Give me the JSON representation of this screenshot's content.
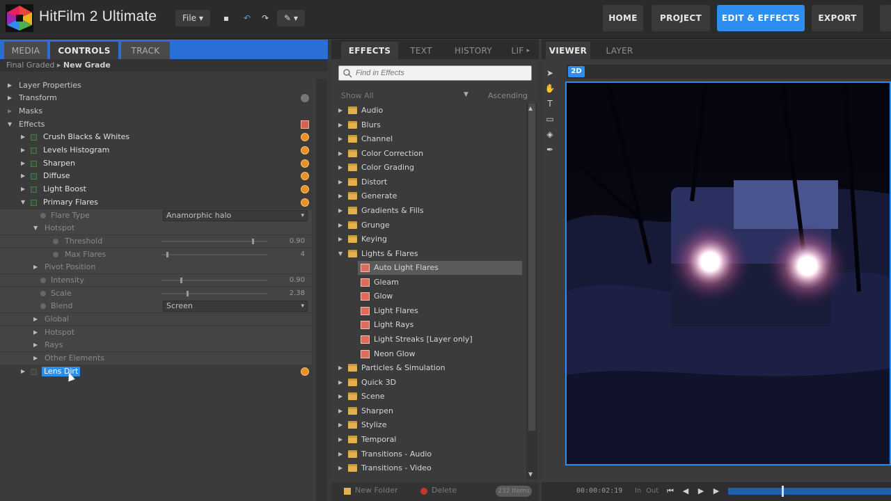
{
  "app": {
    "title": "HitFilm 2 Ultimate",
    "file_menu": "File",
    "nav": [
      "HOME",
      "PROJECT",
      "EDIT & EFFECTS",
      "EXPORT"
    ]
  },
  "left_panel": {
    "tabs": [
      "MEDIA",
      "CONTROLS",
      "TRACK"
    ],
    "breadcrumb": {
      "parent": "Final Graded",
      "current": "New Grade"
    },
    "rows": [
      {
        "label": "Layer Properties"
      },
      {
        "label": "Transform"
      },
      {
        "label": "Masks"
      },
      {
        "label": "Effects"
      },
      {
        "label": "Crush Blacks & Whites"
      },
      {
        "label": "Levels Histogram"
      },
      {
        "label": "Sharpen"
      },
      {
        "label": "Diffuse"
      },
      {
        "label": "Light Boost"
      },
      {
        "label": "Primary Flares"
      },
      {
        "label": "Flare Type",
        "value": "Anamorphic halo"
      },
      {
        "label": "Hotspot"
      },
      {
        "label": "Threshold",
        "value": "0.90",
        "slider": 0.88
      },
      {
        "label": "Max Flares",
        "value": "4",
        "slider": 0.05
      },
      {
        "label": "Pivot Position"
      },
      {
        "label": "Intensity",
        "value": "0.90",
        "slider": 0.18
      },
      {
        "label": "Scale",
        "value": "2.38",
        "slider": 0.24
      },
      {
        "label": "Blend",
        "value": "Screen"
      },
      {
        "label": "Global"
      },
      {
        "label": "Hotspot"
      },
      {
        "label": "Rays"
      },
      {
        "label": "Other Elements"
      },
      {
        "label": "Lens Dirt"
      }
    ]
  },
  "effects_panel": {
    "tabs": [
      "EFFECTS",
      "TEXT",
      "HISTORY",
      "LIF"
    ],
    "search_placeholder": "Find in Effects",
    "filter": "Show All",
    "sort": "Ascending",
    "items": [
      {
        "label": "Audio"
      },
      {
        "label": "Blurs"
      },
      {
        "label": "Channel"
      },
      {
        "label": "Color Correction"
      },
      {
        "label": "Color Grading"
      },
      {
        "label": "Distort"
      },
      {
        "label": "Generate"
      },
      {
        "label": "Gradients & Fills"
      },
      {
        "label": "Grunge"
      },
      {
        "label": "Keying"
      },
      {
        "label": "Lights & Flares"
      },
      {
        "label": "Auto Light Flares"
      },
      {
        "label": "Gleam"
      },
      {
        "label": "Glow"
      },
      {
        "label": "Light Flares"
      },
      {
        "label": "Light Rays"
      },
      {
        "label": "Light Streaks [Layer only]"
      },
      {
        "label": "Neon Glow"
      },
      {
        "label": "Particles & Simulation"
      },
      {
        "label": "Quick 3D"
      },
      {
        "label": "Scene"
      },
      {
        "label": "Sharpen"
      },
      {
        "label": "Stylize"
      },
      {
        "label": "Temporal"
      },
      {
        "label": "Transitions - Audio"
      },
      {
        "label": "Transitions - Video"
      }
    ],
    "new_folder": "New Folder",
    "delete": "Delete",
    "count": "232 Items"
  },
  "viewer": {
    "tabs": [
      "VIEWER",
      "LAYER"
    ],
    "mode": "2D",
    "timecode": "00:00:02:19",
    "in": "In",
    "out": "Out",
    "playhead": 0.33
  }
}
